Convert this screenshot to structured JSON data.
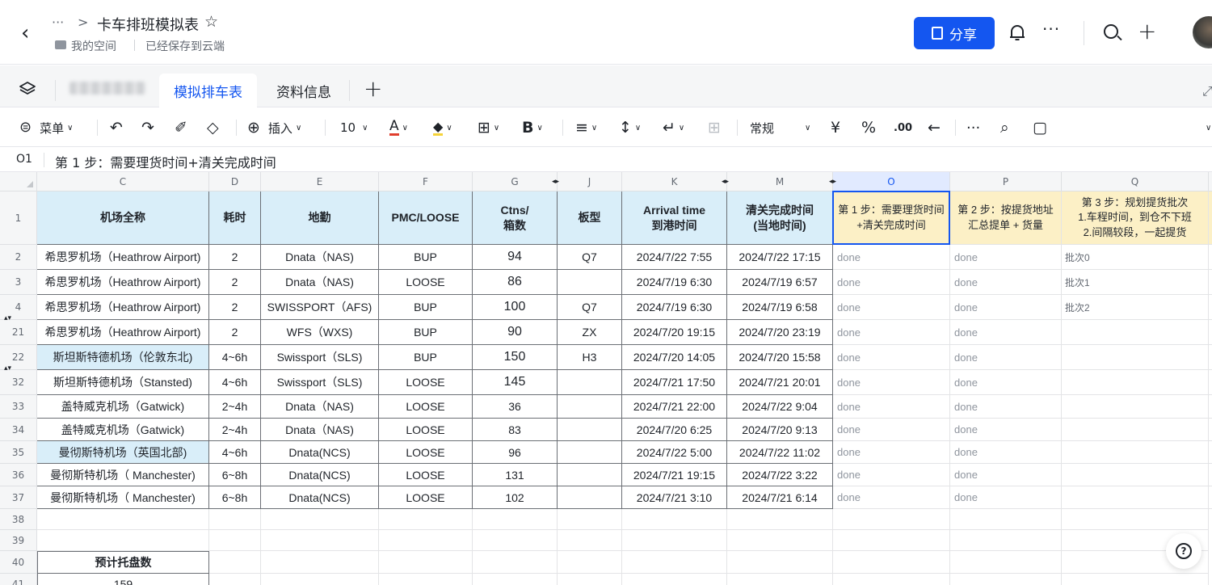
{
  "header": {
    "title": "卡车排班模拟表",
    "breadcrumb_dots": "···",
    "breadcrumb_sep": ">",
    "space_label": "我的空间",
    "saved_status": "已经保存到云端",
    "share_label": "分享",
    "more": "···"
  },
  "tabs": [
    {
      "label": "模拟排车表",
      "active": true
    },
    {
      "label": "资料信息",
      "active": false
    }
  ],
  "toolbar": {
    "menu_label": "菜单",
    "insert_label": "插入",
    "font_size": "10",
    "number_format": "常规",
    "currency": "¥",
    "percent": "%",
    "decimals_more": ".00",
    "more": "···"
  },
  "formula_bar": {
    "cell_ref": "O1",
    "content": "第 1 步：需要理货时间+清关完成时间"
  },
  "columns": [
    "C",
    "D",
    "E",
    "F",
    "G",
    "J",
    "K",
    "M",
    "O",
    "P",
    "Q"
  ],
  "header_row": {
    "row_num": "1",
    "cells": [
      "机场全称",
      "耗时",
      "地勤",
      "PMC/LOOSE",
      "Ctns/\n箱数",
      "板型",
      "Arrival time\n到港时间",
      "清关完成时间\n(当地时间)",
      "第 1 步：需要理货时间\n+清关完成时间",
      "第 2 步：按提货地址\n汇总提单 + 货量",
      "第 3 步：规划提货批次\n1.车程时间，到仓不下班\n2.间隔较段，一起提货"
    ]
  },
  "rows": [
    {
      "num": "2",
      "cells": [
        "希思罗机场（Heathrow Airport)",
        "2",
        "Dnata（NAS)",
        "BUP",
        "94",
        "Q7",
        "2024/7/22 7:55",
        "2024/7/22 17:15",
        "done",
        "done",
        "批次0"
      ]
    },
    {
      "num": "3",
      "cells": [
        "希思罗机场（Heathrow Airport)",
        "2",
        "Dnata（NAS)",
        "LOOSE",
        "86",
        "",
        "2024/7/19 6:30",
        "2024/7/19 6:57",
        "done",
        "done",
        "批次1"
      ]
    },
    {
      "num": "4",
      "cells": [
        "希思罗机场（Heathrow Airport)",
        "2",
        "SWISSPORT（AFS)",
        "BUP",
        "100",
        "Q7",
        "2024/7/19 6:30",
        "2024/7/19 6:58",
        "done",
        "done",
        "批次2"
      ]
    },
    {
      "num": "21",
      "cells": [
        "希思罗机场（Heathrow Airport)",
        "2",
        "WFS（WXS)",
        "BUP",
        "90",
        "ZX",
        "2024/7/20 19:15",
        "2024/7/20 23:19",
        "done",
        "done",
        ""
      ]
    },
    {
      "num": "22",
      "cells": [
        "斯坦斯特德机场（伦敦东北)",
        "4~6h",
        "Swissport（SLS)",
        "BUP",
        "150",
        "H3",
        "2024/7/20 14:05",
        "2024/7/20 15:58",
        "done",
        "done",
        ""
      ]
    },
    {
      "num": "32",
      "cells": [
        "斯坦斯特德机场（Stansted)",
        "4~6h",
        "Swissport（SLS)",
        "LOOSE",
        "145",
        "",
        "2024/7/21 17:50",
        "2024/7/21 20:01",
        "done",
        "done",
        ""
      ]
    },
    {
      "num": "33",
      "cells": [
        "盖特威克机场（Gatwick)",
        "2~4h",
        "Dnata（NAS)",
        "LOOSE",
        "36",
        "",
        "2024/7/21 22:00",
        "2024/7/22 9:04",
        "done",
        "done",
        ""
      ]
    },
    {
      "num": "34",
      "cells": [
        "盖特威克机场（Gatwick)",
        "2~4h",
        "Dnata（NAS)",
        "LOOSE",
        "83",
        "",
        "2024/7/20 6:25",
        "2024/7/20 9:13",
        "done",
        "done",
        ""
      ]
    },
    {
      "num": "35",
      "cells": [
        "曼彻斯特机场（英国北部)",
        "4~6h",
        "Dnata(NCS)",
        "LOOSE",
        "96",
        "",
        "2024/7/22 5:00",
        "2024/7/22 11:02",
        "done",
        "done",
        ""
      ]
    },
    {
      "num": "36",
      "cells": [
        "曼彻斯特机场（ Manchester)",
        "6~8h",
        "Dnata(NCS)",
        "LOOSE",
        "131",
        "",
        "2024/7/21 19:15",
        "2024/7/22 3:22",
        "done",
        "done",
        ""
      ]
    },
    {
      "num": "37",
      "cells": [
        "曼彻斯特机场（ Manchester)",
        "6~8h",
        "Dnata(NCS)",
        "LOOSE",
        "102",
        "",
        "2024/7/21 3:10",
        "2024/7/21 6:14",
        "done",
        "done",
        ""
      ]
    }
  ],
  "empty_rows": [
    "38",
    "39"
  ],
  "extra_rows": [
    {
      "num": "40",
      "label": "预计托盘数"
    },
    {
      "num": "41",
      "label": "159"
    }
  ],
  "colors": {
    "accent": "#1456f0",
    "header_blue": "#d9eef9",
    "header_yellow": "#fcf0c6"
  }
}
